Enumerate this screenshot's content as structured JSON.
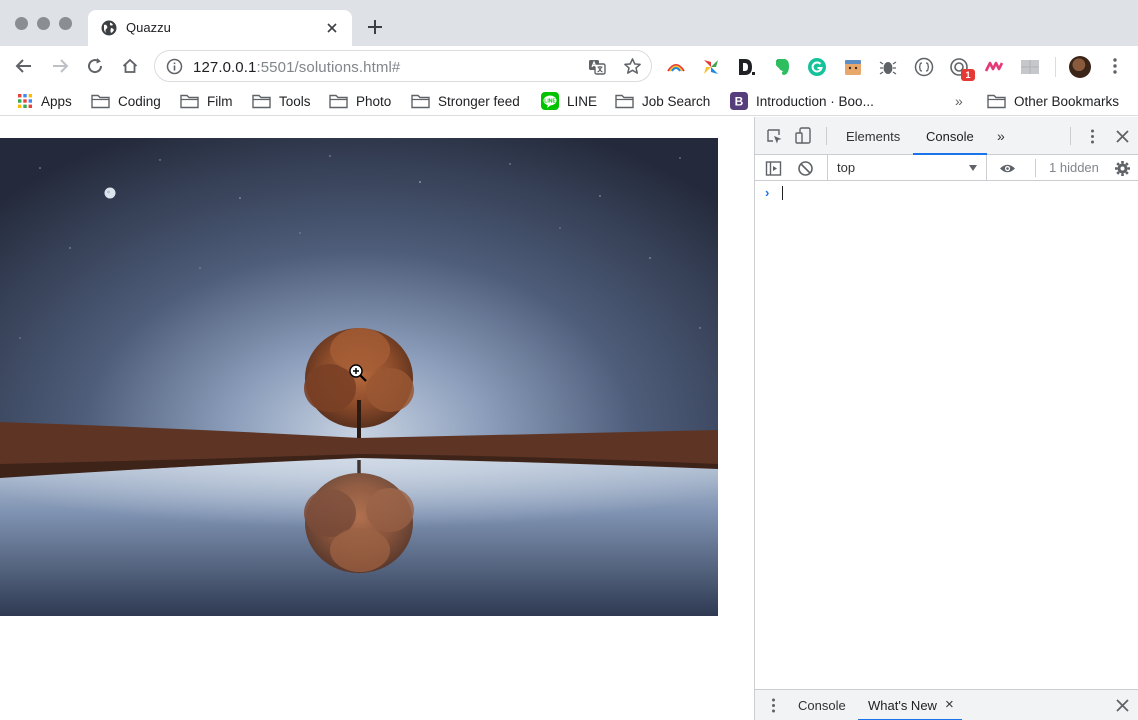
{
  "browser": {
    "tab": {
      "title": "Quazzu"
    },
    "address": {
      "host": "127.0.0.1",
      "path": ":5501/solutions.html#"
    },
    "extensions": {
      "badge_count": "1"
    }
  },
  "bookmarks": {
    "items": [
      {
        "label": "Apps",
        "icon": "apps-grid-icon"
      },
      {
        "label": "Coding",
        "icon": "folder-icon"
      },
      {
        "label": "Film",
        "icon": "folder-icon"
      },
      {
        "label": "Tools",
        "icon": "folder-icon"
      },
      {
        "label": "Photo",
        "icon": "folder-icon"
      },
      {
        "label": "Stronger feed",
        "icon": "folder-icon"
      },
      {
        "label": "LINE",
        "icon": "line-app-icon"
      },
      {
        "label": "Job Search",
        "icon": "folder-icon"
      },
      {
        "label": "Introduction · Boo...",
        "icon": "bootstrap-icon"
      }
    ],
    "overflow": "»",
    "other": "Other Bookmarks"
  },
  "devtools": {
    "tabs": {
      "elements": "Elements",
      "console": "Console",
      "more": "»"
    },
    "context": "top",
    "hidden": "1 hidden",
    "prompt": "›",
    "drawer": {
      "console": "Console",
      "whats_new": "What's New",
      "close": "×"
    }
  },
  "colors": {
    "accent": "#1a73e8",
    "tab_strip": "#dee1e6",
    "devtools_bar": "#f1f3f4"
  }
}
